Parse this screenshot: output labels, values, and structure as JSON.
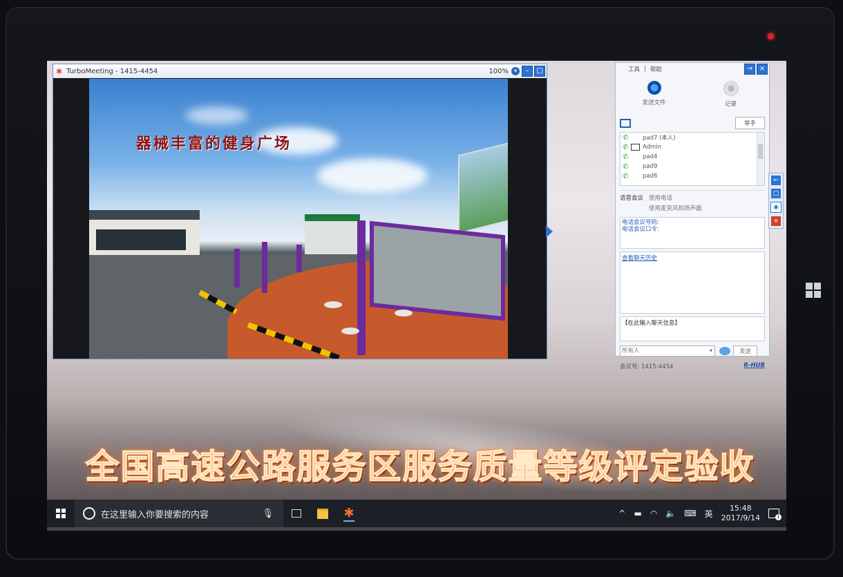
{
  "viewer": {
    "title": "TurboMeeting - 1415-4454",
    "zoom": "100%"
  },
  "slide": {
    "heading": "器械丰富的健身广场"
  },
  "panel": {
    "menu_tools": "工具",
    "menu_sep": "|",
    "menu_help": "帮助",
    "send_file": "发送文件",
    "record": "记录",
    "raise_hand": "举手",
    "attendees": [
      "pad7 (本人)",
      "Admin",
      "pad4",
      "pad9",
      "pad6"
    ],
    "voice_label": "语音会议",
    "voice_option_phone": "使用电话",
    "voice_option_mic": "使用麦克风和扬声器",
    "phone_number_label": "电话会议号码:",
    "phone_password_label": "电话会议口令:",
    "chat_history_link": "查看聊天历史",
    "chat_placeholder": "【在此输入聊天信息】",
    "recipient": "所有人",
    "send_button": "发送",
    "meeting_id": "会议号: 1415-4454",
    "brand": "R-HUB"
  },
  "banner_text": "全国高速公路服务区服务质量等级评定验收",
  "taskbar": {
    "search_placeholder": "在这里输入你要搜索的内容",
    "ime": "英",
    "time": "15:48",
    "date": "2017/9/14",
    "notifications": "1"
  },
  "colors": {
    "accent": "#2b74d6",
    "banner_orange": "#f4a15a",
    "slide_heading": "#8c1418"
  }
}
